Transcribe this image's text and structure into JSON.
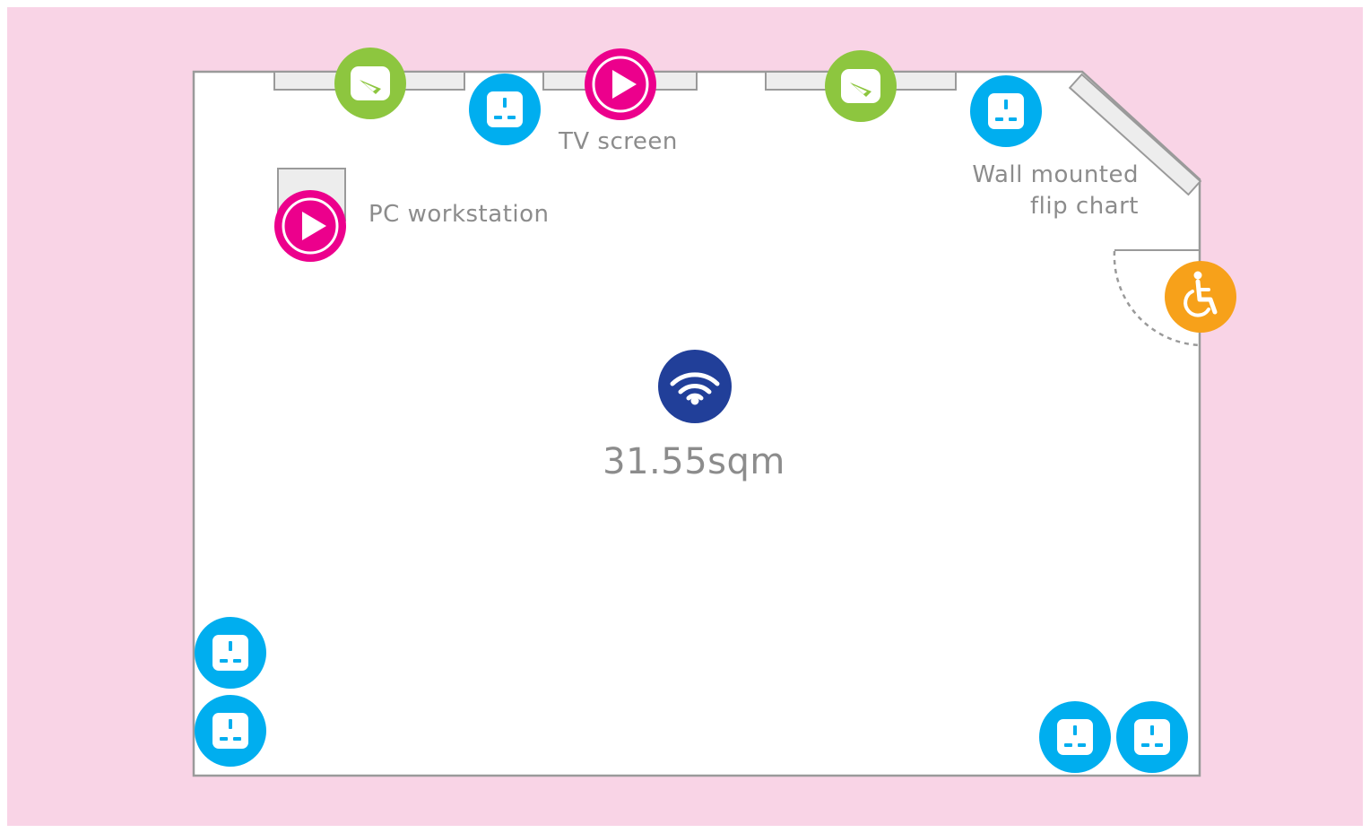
{
  "colors": {
    "page_background": "#f9d4e6",
    "room_fill": "#ffffff",
    "wall_stroke": "#9a9a9a",
    "fixture_fill": "#ededed",
    "power": "#00aeef",
    "display": "#ec008c",
    "writing": "#8dc63f",
    "accessible": "#f7a11a",
    "wifi": "#213f99",
    "label_text": "#8c8c8c"
  },
  "room": {
    "area": "31.55sqm"
  },
  "labels": {
    "tv_screen": "TV screen",
    "pc_workstation": "PC workstation",
    "flip_chart_line1": "Wall mounted",
    "flip_chart_line2": "flip chart"
  },
  "icons": {
    "power": "power-socket-icon",
    "display": "play-icon",
    "writing": "whiteboard-pen-icon",
    "accessible": "wheelchair-icon",
    "wifi": "wifi-icon"
  }
}
